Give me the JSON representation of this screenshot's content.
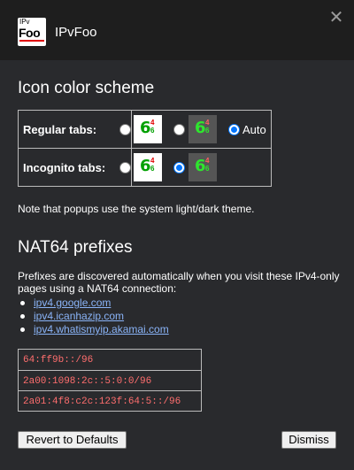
{
  "window": {
    "title": "IPvFoo",
    "logo": {
      "top_text": "IPv",
      "main_text": "Foo"
    },
    "close_glyph": "✕"
  },
  "icon_scheme": {
    "heading": "Icon color scheme",
    "rows": [
      {
        "label": "Regular tabs:",
        "options": [
          {
            "swatch": "light",
            "checked": false
          },
          {
            "swatch": "dark",
            "checked": false
          },
          {
            "label": "Auto",
            "checked": true
          }
        ]
      },
      {
        "label": "Incognito tabs:",
        "options": [
          {
            "swatch": "light",
            "checked": false
          },
          {
            "swatch": "dark",
            "checked": true
          }
        ]
      }
    ],
    "swatch_glyph": {
      "big": "6",
      "small_top": "4",
      "small_bottom": "6"
    },
    "note": "Note that popups use the system light/dark theme."
  },
  "nat64": {
    "heading": "NAT64 prefixes",
    "description": "Prefixes are discovered automatically when you visit these IPv4-only pages using a NAT64 connection:",
    "links": [
      "ipv4.google.com",
      "ipv4.icanhazip.com",
      "ipv4.whatismyip.akamai.com"
    ],
    "prefixes": [
      "64:ff9b::/96",
      "2a00:1098:2c::5:0:0/96",
      "2a01:4f8:c2c:123f:64:5::/96"
    ]
  },
  "buttons": {
    "revert": "Revert to Defaults",
    "dismiss": "Dismiss"
  },
  "colors": {
    "background": "#292a2d",
    "titlebar": "#1e1e1e",
    "link": "#8ab4f8",
    "prefix_text": "#ff6e6e",
    "radio_accent": "#0075ff"
  }
}
